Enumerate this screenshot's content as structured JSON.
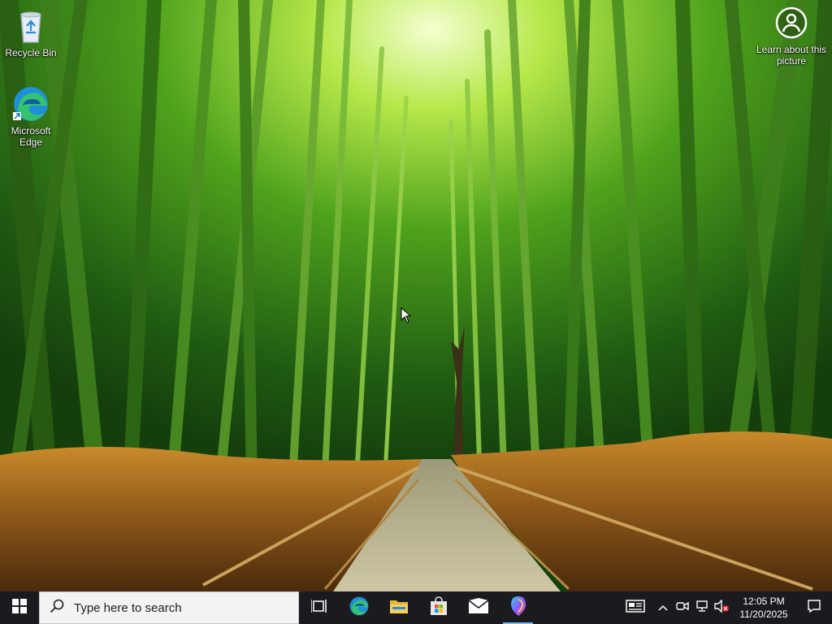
{
  "desktop": {
    "icons": [
      {
        "label": "Recycle Bin",
        "icon": "recycle-bin-icon"
      },
      {
        "label": "Microsoft Edge",
        "icon": "edge-icon"
      }
    ],
    "learn_about": {
      "label": "Learn about this picture",
      "icon": "camera-icon"
    }
  },
  "taskbar": {
    "search_placeholder": "Type here to search",
    "apps": [
      {
        "name": "Task View",
        "icon": "task-view-icon"
      },
      {
        "name": "Microsoft Edge",
        "icon": "edge-icon"
      },
      {
        "name": "File Explorer",
        "icon": "folder-icon"
      },
      {
        "name": "Microsoft Store",
        "icon": "store-icon"
      },
      {
        "name": "Mail",
        "icon": "mail-icon"
      },
      {
        "name": "Copilot",
        "icon": "copilot-icon",
        "active": true
      }
    ],
    "tray": {
      "icons": [
        "news-icon",
        "chevron-up-icon",
        "meet-now-icon",
        "network-icon",
        "volume-muted-icon"
      ],
      "time": "12:05 PM",
      "date": "11/20/2025"
    }
  }
}
